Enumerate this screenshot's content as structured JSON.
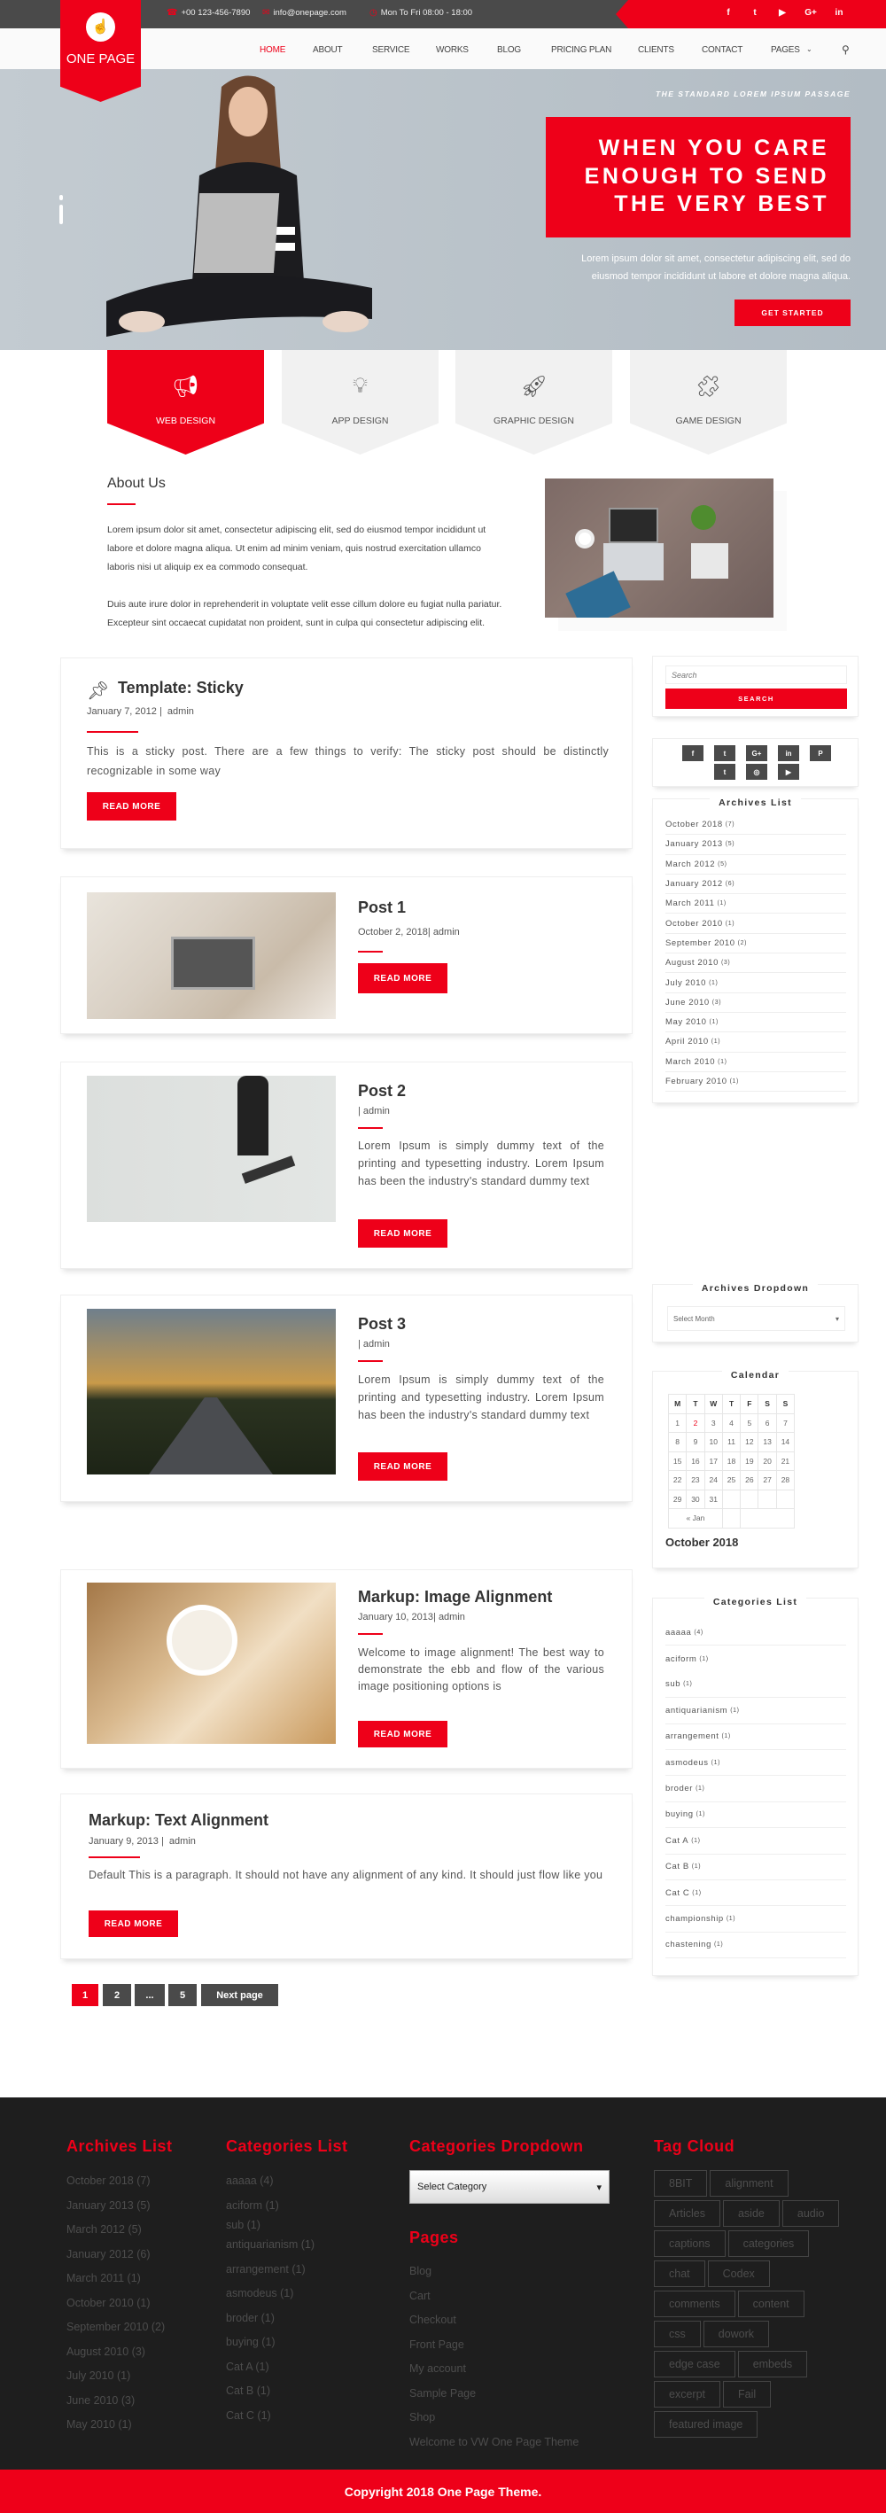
{
  "colors": {
    "accent": "#ee0019",
    "dark": "#4a4a4a",
    "footer_bg": "#1e1e1e"
  },
  "topbar": {
    "phone": "+00 123-456-7890",
    "email": "info@onepage.com",
    "hours": "Mon To Fri 08:00 - 18:00",
    "social": [
      {
        "icon": "facebook-icon",
        "glyph": "f"
      },
      {
        "icon": "twitter-icon",
        "glyph": "t"
      },
      {
        "icon": "youtube-icon",
        "glyph": "▶"
      },
      {
        "icon": "google-plus-icon",
        "glyph": "G+"
      },
      {
        "icon": "linkedin-icon",
        "glyph": "in"
      }
    ]
  },
  "logo": {
    "text": "ONE PAGE"
  },
  "nav": {
    "items": [
      "HOME",
      "ABOUT",
      "SERVICE",
      "WORKS",
      "BLOG",
      "PRICING PLAN",
      "CLIENTS",
      "CONTACT",
      "PAGES"
    ],
    "active": "HOME",
    "search_icon": "search-icon"
  },
  "hero": {
    "kicker": "THE STANDARD LOREM IPSUM PASSAGE",
    "headline": [
      "WHEN YOU CARE",
      "ENOUGH TO SEND",
      "THE VERY BEST"
    ],
    "text": [
      "Lorem ipsum dolor sit amet, consectetur adipiscing elit, sed do",
      "eiusmod tempor incididunt ut labore et dolore magna aliqua."
    ],
    "button": "GET STARTED"
  },
  "services": [
    {
      "label": "WEB DESIGN",
      "icon": "megaphone-icon",
      "active": true
    },
    {
      "label": "APP DESIGN",
      "icon": "lightbulb-icon"
    },
    {
      "label": "GRAPHIC DESIGN",
      "icon": "rocket-icon"
    },
    {
      "label": "GAME DESIGN",
      "icon": "puzzle-icon"
    }
  ],
  "about": {
    "title": "About Us",
    "p1": [
      "Lorem ipsum dolor sit amet, consectetur adipiscing elit, sed do eiusmod tempor incididunt ut",
      "labore et dolore magna aliqua. Ut enim ad minim veniam, quis nostrud exercitation ullamco",
      "laboris nisi ut aliquip ex ea commodo consequat."
    ],
    "p2": [
      "Duis aute irure dolor in reprehenderit in voluptate velit esse cillum dolore eu fugiat nulla pariatur.",
      "Excepteur sint occaecat cupidatat non proident, sunt in culpa qui consectetur adipiscing elit."
    ]
  },
  "posts": [
    {
      "title": "Template: Sticky",
      "date": "January 7, 2012",
      "author": "admin",
      "sticky": true,
      "excerpt": "This is a sticky post. There are a few things to verify: The sticky post should be distinctly recognizable in some way",
      "button": "READ MORE"
    },
    {
      "title": "Post 1",
      "date": "October 2, 2018",
      "author": "admin",
      "excerpt": "",
      "button": "READ MORE"
    },
    {
      "title": "Post 2",
      "date": "",
      "author": "admin",
      "excerpt": "Lorem Ipsum is simply dummy text of the printing and typesetting industry. Lorem Ipsum has been the industry's standard dummy text",
      "button": "READ MORE"
    },
    {
      "title": "Post 3",
      "date": "",
      "author": "admin",
      "excerpt": "Lorem Ipsum is simply dummy text of the printing and typesetting industry. Lorem Ipsum has been the industry's standard dummy text",
      "button": "READ MORE"
    },
    {
      "title": "Markup: Image Alignment",
      "date": "January 10, 2013",
      "author": "admin",
      "excerpt": "Welcome to image alignment! The best way to demonstrate the ebb and flow of the various image positioning options is",
      "button": "READ MORE"
    },
    {
      "title": "Markup: Text Alignment",
      "date": "January 9, 2013",
      "author": "admin",
      "excerpt": "Default This is a paragraph. It should not have any alignment of any kind. It should just flow like you",
      "button": "READ MORE"
    }
  ],
  "pagination": {
    "pages": [
      "1",
      "2",
      "...",
      "5"
    ],
    "current": "1",
    "next": "Next page"
  },
  "sidebar": {
    "search": {
      "placeholder": "Search",
      "button": "SEARCH"
    },
    "social": [
      {
        "icon": "facebook-icon",
        "glyph": "f"
      },
      {
        "icon": "twitter-icon",
        "glyph": "t"
      },
      {
        "icon": "google-plus-icon",
        "glyph": "G+"
      },
      {
        "icon": "linkedin-icon",
        "glyph": "in"
      },
      {
        "icon": "pinterest-icon",
        "glyph": "P"
      },
      {
        "icon": "tumblr-icon",
        "glyph": "t"
      },
      {
        "icon": "instagram-icon",
        "glyph": "◎"
      },
      {
        "icon": "youtube-icon",
        "glyph": "▶"
      }
    ],
    "archives_title": "Archives List",
    "archives": [
      [
        "October 2018",
        "(7)"
      ],
      [
        "January 2013",
        "(5)"
      ],
      [
        "March 2012",
        "(5)"
      ],
      [
        "January 2012",
        "(6)"
      ],
      [
        "March 2011",
        "(1)"
      ],
      [
        "October 2010",
        "(1)"
      ],
      [
        "September 2010",
        "(2)"
      ],
      [
        "August 2010",
        "(3)"
      ],
      [
        "July 2010",
        "(1)"
      ],
      [
        "June 2010",
        "(3)"
      ],
      [
        "May 2010",
        "(1)"
      ],
      [
        "April 2010",
        "(1)"
      ],
      [
        "March 2010",
        "(1)"
      ],
      [
        "February 2010",
        "(1)"
      ]
    ],
    "archives_dropdown_title": "Archives Dropdown",
    "archives_dropdown_value": "Select Month",
    "calendar_title": "Calendar",
    "calendar": {
      "days": [
        "M",
        "T",
        "W",
        "T",
        "F",
        "S",
        "S"
      ],
      "weeks": [
        [
          "1",
          "2",
          "3",
          "4",
          "5",
          "6",
          "7"
        ],
        [
          "8",
          "9",
          "10",
          "11",
          "12",
          "13",
          "14"
        ],
        [
          "15",
          "16",
          "17",
          "18",
          "19",
          "20",
          "21"
        ],
        [
          "22",
          "23",
          "24",
          "25",
          "26",
          "27",
          "28"
        ],
        [
          "29",
          "30",
          "31",
          "",
          "",
          "",
          ""
        ]
      ],
      "today": "2",
      "prev": "« Jan",
      "caption": "October 2018"
    },
    "categories_title": "Categories List",
    "categories": [
      [
        "aaaaa",
        "(4)"
      ],
      [
        "aciform",
        "(1)"
      ],
      [
        "sub",
        "(1)"
      ],
      [
        "antiquarianism",
        "(1)"
      ],
      [
        "arrangement",
        "(1)"
      ],
      [
        "asmodeus",
        "(1)"
      ],
      [
        "broder",
        "(1)"
      ],
      [
        "buying",
        "(1)"
      ],
      [
        "Cat A",
        "(1)"
      ],
      [
        "Cat B",
        "(1)"
      ],
      [
        "Cat C",
        "(1)"
      ],
      [
        "championship",
        "(1)"
      ],
      [
        "chastening",
        "(1)"
      ]
    ]
  },
  "footer": {
    "archives_title": "Archives List",
    "archives": [
      "October 2018 (7)",
      "January 2013 (5)",
      "March 2012 (5)",
      "January 2012 (6)",
      "March 2011 (1)",
      "October 2010 (1)",
      "September 2010 (2)",
      "August 2010 (3)",
      "July 2010 (1)",
      "June 2010 (3)",
      "May 2010 (1)"
    ],
    "categories_title": "Categories List",
    "categories": [
      "aaaaa (4)",
      "aciform (1)",
      "sub (1)",
      "antiquarianism (1)",
      "arrangement (1)",
      "asmodeus (1)",
      "broder (1)",
      "buying (1)",
      "Cat A (1)",
      "Cat B (1)",
      "Cat C (1)"
    ],
    "dropdown_title": "Categories Dropdown",
    "dropdown_value": "Select Category",
    "pages_title": "Pages",
    "pages": [
      "Blog",
      "Cart",
      "Checkout",
      "Front Page",
      "My account",
      "Sample Page",
      "Shop",
      "Welcome to VW One Page Theme"
    ],
    "tags_title": "Tag Cloud",
    "tags": [
      [
        "8BIT",
        "alignment"
      ],
      [
        "Articles",
        "aside",
        "audio"
      ],
      [
        "captions",
        "categories"
      ],
      [
        "chat",
        "Codex"
      ],
      [
        "comments",
        "content"
      ],
      [
        "css",
        "dowork"
      ],
      [
        "edge case",
        "embeds"
      ],
      [
        "excerpt",
        "Fail"
      ],
      [
        "featured image"
      ]
    ],
    "copyright": "Copyright 2018 One Page Theme."
  }
}
